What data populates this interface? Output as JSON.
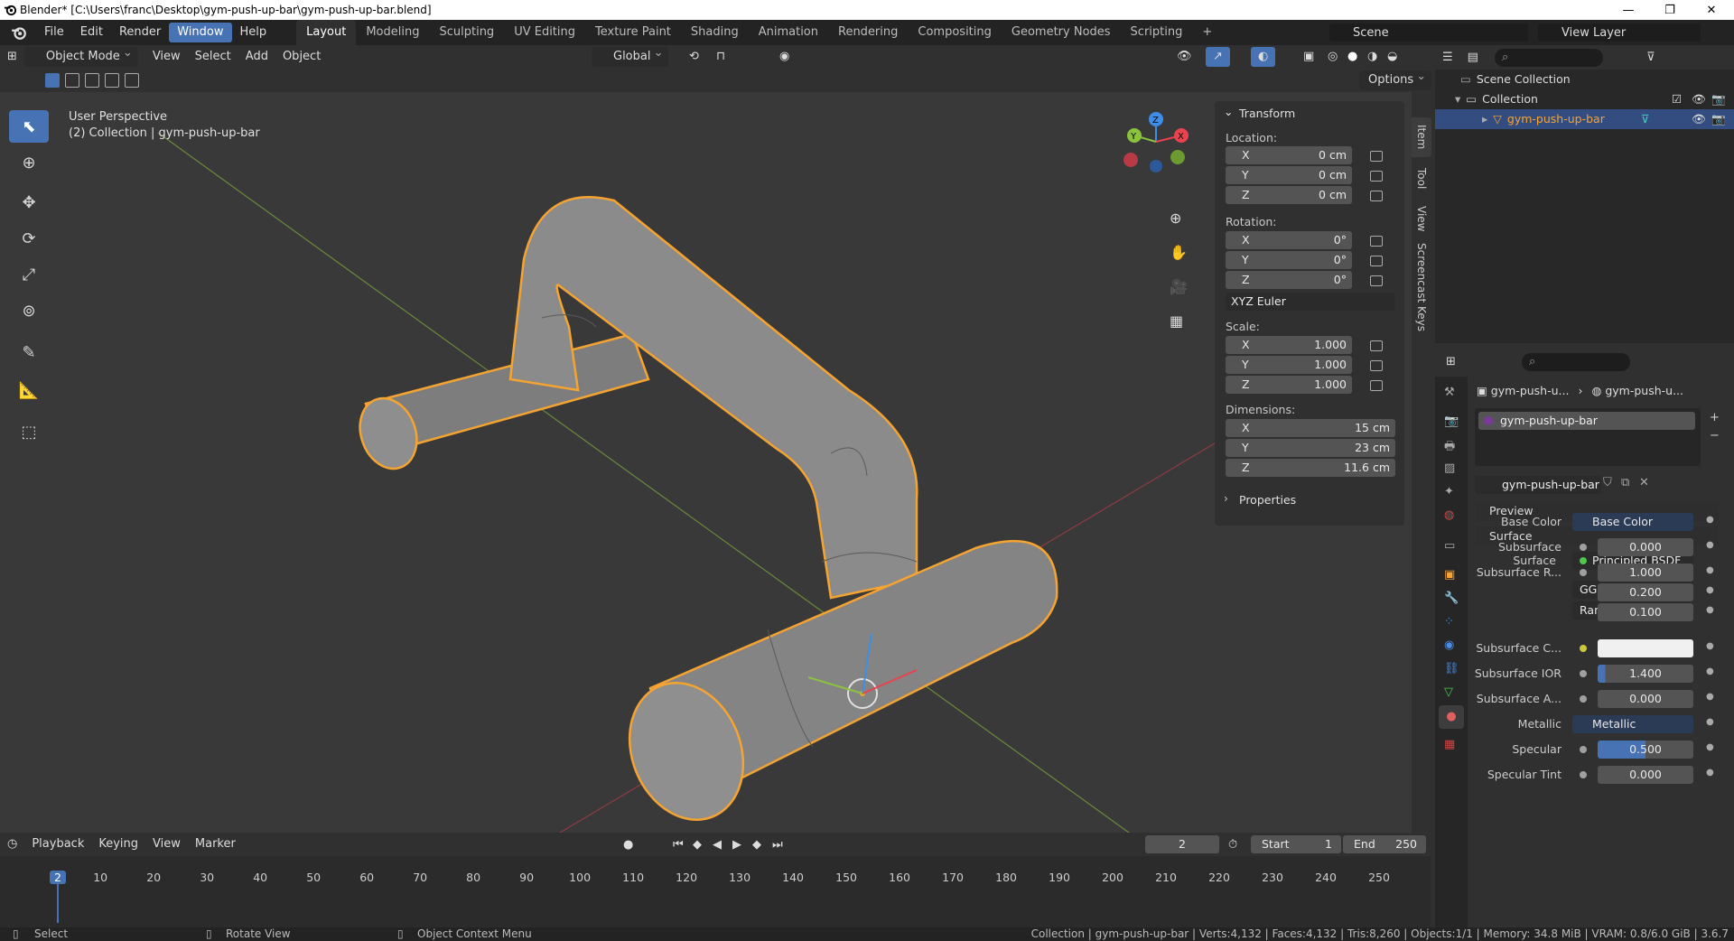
{
  "window": {
    "title": "Blender* [C:\\Users\\franc\\Desktop\\gym-push-up-bar\\gym-push-up-bar.blend]",
    "min": "—",
    "max": "❐",
    "close": "✕"
  },
  "menus": [
    "File",
    "Edit",
    "Render",
    "Window",
    "Help"
  ],
  "workspaces": [
    "Layout",
    "Modeling",
    "Sculpting",
    "UV Editing",
    "Texture Paint",
    "Shading",
    "Animation",
    "Rendering",
    "Compositing",
    "Geometry Nodes",
    "Scripting",
    "+"
  ],
  "scene": "Scene",
  "view_layer": "View Layer",
  "viewport_header": {
    "mode": "Object Mode",
    "menus": [
      "View",
      "Select",
      "Add",
      "Object"
    ],
    "orientation": "Global",
    "options": "Options"
  },
  "overlay": {
    "perspective": "User Perspective",
    "collection": "(2) Collection | gym-push-up-bar"
  },
  "gizmo": {
    "x": "X",
    "y": "Y",
    "z": "Z"
  },
  "npanel": {
    "title": "Transform",
    "location_label": "Location:",
    "location": [
      {
        "axis": "X",
        "value": "0 cm"
      },
      {
        "axis": "Y",
        "value": "0 cm"
      },
      {
        "axis": "Z",
        "value": "0 cm"
      }
    ],
    "rotation_label": "Rotation:",
    "rotation": [
      {
        "axis": "X",
        "value": "0°"
      },
      {
        "axis": "Y",
        "value": "0°"
      },
      {
        "axis": "Z",
        "value": "0°"
      }
    ],
    "rotation_mode": "XYZ Euler",
    "scale_label": "Scale:",
    "scale": [
      {
        "axis": "X",
        "value": "1.000"
      },
      {
        "axis": "Y",
        "value": "1.000"
      },
      {
        "axis": "Z",
        "value": "1.000"
      }
    ],
    "dimensions_label": "Dimensions:",
    "dimensions": [
      {
        "axis": "X",
        "value": "15 cm"
      },
      {
        "axis": "Y",
        "value": "23 cm"
      },
      {
        "axis": "Z",
        "value": "11.6 cm"
      }
    ],
    "properties": "Properties"
  },
  "side_tabs": [
    "Item",
    "Tool",
    "View",
    "Screencast Keys"
  ],
  "outliner": {
    "scene_collection": "Scene Collection",
    "collection": "Collection",
    "object": "gym-push-up-bar"
  },
  "properties": {
    "breadcrumb_obj": "gym-push-u...",
    "breadcrumb_mat": "gym-push-u...",
    "material_slot": "gym-push-up-bar",
    "material_name": "gym-push-up-bar",
    "preview": "Preview",
    "surface_panel": "Surface",
    "surface_label": "Surface",
    "surface_value": "Principled BSDF",
    "dist": "GGX",
    "sss_method": "Random Walk",
    "rows": [
      {
        "label": "Base Color",
        "value": "Base Color",
        "kind": "link"
      },
      {
        "label": "Subsurface",
        "value": "0.000",
        "kind": "num"
      },
      {
        "label": "Subsurface R...",
        "value": "1.000",
        "kind": "num"
      },
      {
        "label": "",
        "value": "0.200",
        "kind": "num"
      },
      {
        "label": "",
        "value": "0.100",
        "kind": "num"
      },
      {
        "label": "Subsurface C...",
        "value": "",
        "kind": "color"
      },
      {
        "label": "Subsurface IOR",
        "value": "1.400",
        "kind": "num"
      },
      {
        "label": "Subsurface A...",
        "value": "0.000",
        "kind": "num"
      },
      {
        "label": "Metallic",
        "value": "Metallic",
        "kind": "link"
      },
      {
        "label": "Specular",
        "value": "0.500",
        "kind": "num"
      },
      {
        "label": "Specular Tint",
        "value": "0.000",
        "kind": "num"
      }
    ]
  },
  "timeline": {
    "menus": [
      "Playback",
      "Keying",
      "View",
      "Marker"
    ],
    "current": "2",
    "start_label": "Start",
    "start": "1",
    "end_label": "End",
    "end": "250",
    "ticks": [
      "2",
      "10",
      "20",
      "30",
      "40",
      "50",
      "60",
      "70",
      "80",
      "90",
      "100",
      "110",
      "120",
      "130",
      "140",
      "150",
      "160",
      "170",
      "180",
      "190",
      "200",
      "210",
      "220",
      "230",
      "240",
      "250"
    ]
  },
  "status": {
    "select": "Select",
    "rotate": "Rotate View",
    "context": "Object Context Menu",
    "info": "Collection | gym-push-up-bar | Verts:4,132 | Faces:4,132 | Tris:8,260 | Objects:1/1 | Memory: 34.8 MiB | VRAM: 0.8/6.0 GiB | 3.6.7"
  },
  "colors": {
    "accent": "#4772b3",
    "selection": "#f5a331",
    "x_axis": "#e8434f",
    "y_axis": "#8ac33e",
    "z_axis": "#3d8ee8"
  }
}
